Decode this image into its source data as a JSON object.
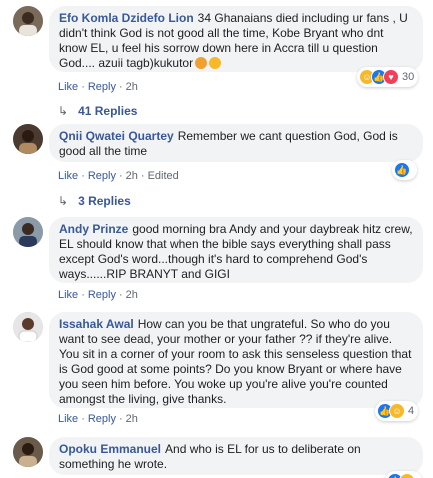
{
  "comments": [
    {
      "author": "Efo Komla Dzidefo Lion",
      "text": "34 Ghanaians died including ur fans , U didn't think God is not good all the time, Kobe Bryant who dnt know EL, u feel his sorrow down here in Accra till u question God.... azuii tagb)kukutor",
      "actions": {
        "like": "Like",
        "reply": "Reply",
        "time": "2h"
      },
      "reactions": {
        "icons": [
          "haha-icon",
          "like-icon",
          "love-icon"
        ],
        "count": "30"
      },
      "replies": "41 Replies"
    },
    {
      "author": "Qnii Qwatei Quartey",
      "text": "Remember we cant question God, God is good all the time",
      "actions": {
        "like": "Like",
        "reply": "Reply",
        "time": "2h",
        "edited": "Edited"
      },
      "reactions": {
        "icons": [
          "like-icon"
        ],
        "count": ""
      },
      "replies": "3 Replies"
    },
    {
      "author": "Andy Prinze",
      "text": "good morning bra Andy and your daybreak hitz crew, EL should know that when the bible says everything shall pass except God's word...though it's hard to comprehend God's ways......RIP BRANYT and GIGI",
      "actions": {
        "like": "Like",
        "reply": "Reply",
        "time": "2h"
      }
    },
    {
      "author": "Issahak Awal",
      "text": "How can you be that ungrateful. So who do you want to see dead, your mother or your father ?? if they're alive. You sit in a corner of your room to ask this senseless question that is God good at some points? Do you know Bryant or where have you seen him before. You woke up you're alive you're counted amongst the living, give thanks.",
      "actions": {
        "like": "Like",
        "reply": "Reply",
        "time": "2h"
      },
      "reactions": {
        "icons": [
          "like-icon",
          "haha-icon"
        ],
        "count": "4"
      }
    },
    {
      "author": "Opoku Emmanuel",
      "text": "And who is EL for us to deliberate on something he wrote.",
      "reactions": {
        "icons": [
          "like-icon",
          "haha-icon"
        ],
        "count": ""
      }
    }
  ],
  "colors": {
    "link": "#385898",
    "bubble": "#f2f3f5",
    "meta": "#606770",
    "like": "#1877f2",
    "haha": "#f7b928",
    "love": "#f33e58"
  }
}
